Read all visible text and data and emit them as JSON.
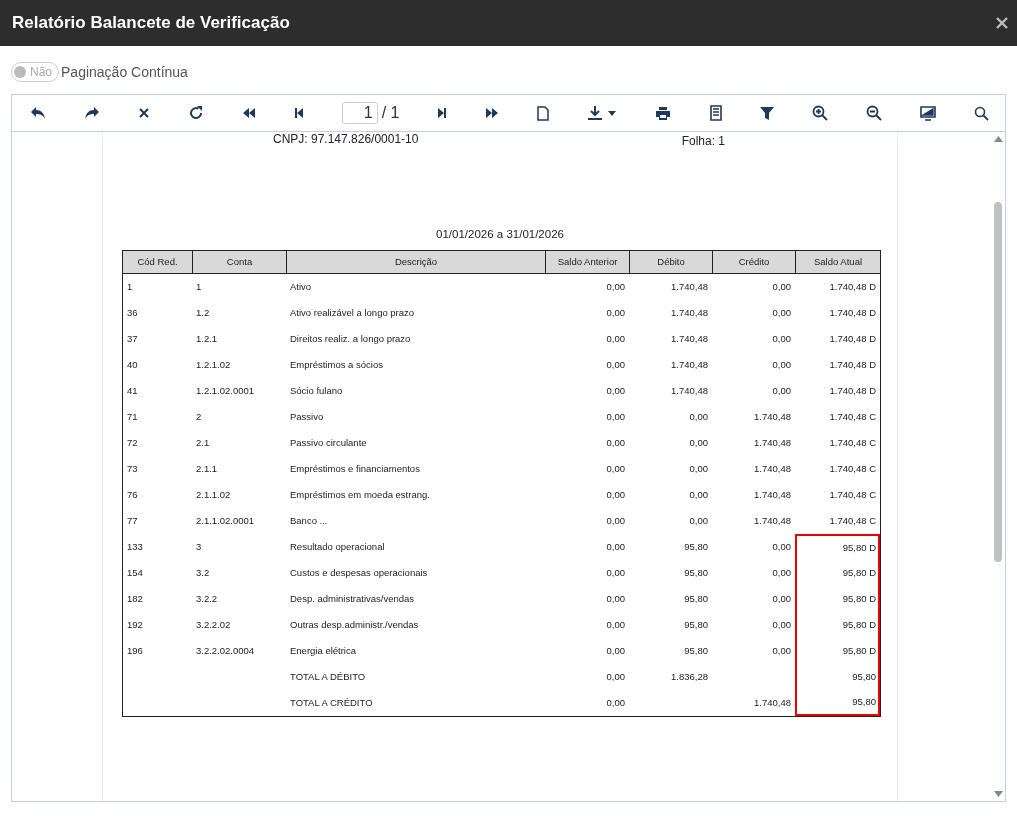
{
  "window": {
    "title": "Relatório Balancete de Verificação"
  },
  "toggle": {
    "label": "Não",
    "on": false,
    "caption": "Paginação Contínua"
  },
  "pager": {
    "page": "1",
    "total": "/ 1"
  },
  "report": {
    "cnpj": "CNPJ: 97.147.826/0001-10",
    "sheet": "Folha: 1",
    "period": "01/01/2026 a 31/01/2026",
    "columns": [
      "Cód Red.",
      "Conta",
      "Descrição",
      "Saldo Anterior",
      "Débito",
      "Crédito",
      "Saldo Atual"
    ],
    "rows": [
      {
        "cells": [
          "1",
          "1",
          "Ativo",
          "0,00",
          "1.740,48",
          "0,00",
          "1.740,48 D"
        ],
        "highlighted": false
      },
      {
        "cells": [
          "36",
          "1.2",
          "Ativo realizável a longo prazo",
          "0,00",
          "1.740,48",
          "0,00",
          "1.740,48 D"
        ],
        "highlighted": false
      },
      {
        "cells": [
          "37",
          "1.2.1",
          "Direitos realiz. a longo prazo",
          "0,00",
          "1.740,48",
          "0,00",
          "1.740,48 D"
        ],
        "highlighted": false
      },
      {
        "cells": [
          "40",
          "1.2.1.02",
          "Empréstimos a sócios",
          "0,00",
          "1.740,48",
          "0,00",
          "1.740,48 D"
        ],
        "highlighted": false
      },
      {
        "cells": [
          "41",
          "1.2.1.02.0001",
          "Sócio fulano",
          "0,00",
          "1.740,48",
          "0,00",
          "1.740,48 D"
        ],
        "highlighted": false
      },
      {
        "cells": [
          "71",
          "2",
          "Passivo",
          "0,00",
          "0,00",
          "1.740,48",
          "1.740,48 C"
        ],
        "highlighted": false
      },
      {
        "cells": [
          "72",
          "2.1",
          "Passivo circulante",
          "0,00",
          "0,00",
          "1.740,48",
          "1.740,48 C"
        ],
        "highlighted": false
      },
      {
        "cells": [
          "73",
          "2.1.1",
          "Empréstimos e financiamentos",
          "0,00",
          "0,00",
          "1.740,48",
          "1.740,48 C"
        ],
        "highlighted": false
      },
      {
        "cells": [
          "76",
          "2.1.1.02",
          "Empréstimos em moeda estrang.",
          "0,00",
          "0,00",
          "1.740,48",
          "1.740,48 C"
        ],
        "highlighted": false
      },
      {
        "cells": [
          "77",
          "2.1.1.02.0001",
          "Banco ...",
          "0,00",
          "0,00",
          "1.740,48",
          "1.740,48 C"
        ],
        "highlighted": false
      },
      {
        "cells": [
          "133",
          "3",
          "Resultado operacional",
          "0,00",
          "95,80",
          "0,00",
          "95,80 D"
        ],
        "highlighted": true
      },
      {
        "cells": [
          "154",
          "3.2",
          "Custos e despesas operacionais",
          "0,00",
          "95,80",
          "0,00",
          "95,80 D"
        ],
        "highlighted": true
      },
      {
        "cells": [
          "182",
          "3.2.2",
          "Desp. administrativas/vendas",
          "0,00",
          "95,80",
          "0,00",
          "95,80 D"
        ],
        "highlighted": true
      },
      {
        "cells": [
          "192",
          "3.2.2.02",
          "Outras desp.administr./vendas",
          "0,00",
          "95,80",
          "0,00",
          "95,80 D"
        ],
        "highlighted": true
      },
      {
        "cells": [
          "196",
          "3.2.2.02.0004",
          "Energia elétrica",
          "0,00",
          "95,80",
          "0,00",
          "95,80 D"
        ],
        "highlighted": true
      },
      {
        "cells": [
          "",
          "",
          "TOTAL A DÉBITO",
          "0,00",
          "1.836,28",
          "",
          "95,80"
        ],
        "highlighted": true
      },
      {
        "cells": [
          "",
          "",
          "TOTAL A CRÉDITO",
          "0,00",
          "",
          "1.740,48",
          "95,80"
        ],
        "highlighted": true
      }
    ]
  }
}
